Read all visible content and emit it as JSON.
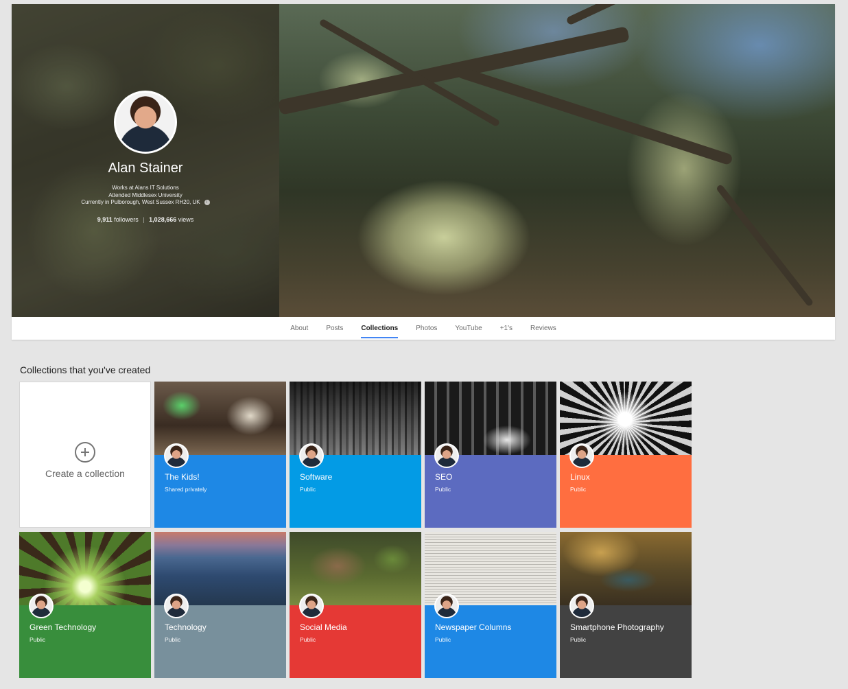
{
  "profile": {
    "name": "Alan Stainer",
    "work": "Works at Alans IT Solutions",
    "education": "Attended Middlesex University",
    "location": "Currently in Pulborough, West Sussex RH20, UK",
    "followers_count": "9,911",
    "followers_label": "followers",
    "views_count": "1,028,666",
    "views_label": "views"
  },
  "tabs": [
    {
      "label": "About"
    },
    {
      "label": "Posts"
    },
    {
      "label": "Collections",
      "active": true
    },
    {
      "label": "Photos"
    },
    {
      "label": "YouTube"
    },
    {
      "label": "+1's"
    },
    {
      "label": "Reviews"
    }
  ],
  "collections": {
    "section_title": "Collections that you've created",
    "create_label": "Create a collection",
    "items": [
      {
        "title": "The Kids!",
        "visibility": "Shared privately",
        "color": "#1e88e5"
      },
      {
        "title": "Software",
        "visibility": "Public",
        "color": "#039be5"
      },
      {
        "title": "SEO",
        "visibility": "Public",
        "color": "#5c6bc0"
      },
      {
        "title": "Linux",
        "visibility": "Public",
        "color": "#ff6e40"
      },
      {
        "title": "Green Technology",
        "visibility": "Public",
        "color": "#388e3c"
      },
      {
        "title": "Technology",
        "visibility": "Public",
        "color": "#78909c"
      },
      {
        "title": "Social Media",
        "visibility": "Public",
        "color": "#e53935"
      },
      {
        "title": "Newspaper Columns",
        "visibility": "Public",
        "color": "#1e88e5"
      },
      {
        "title": "Smartphone Photography",
        "visibility": "Public",
        "color": "#424242"
      }
    ]
  }
}
